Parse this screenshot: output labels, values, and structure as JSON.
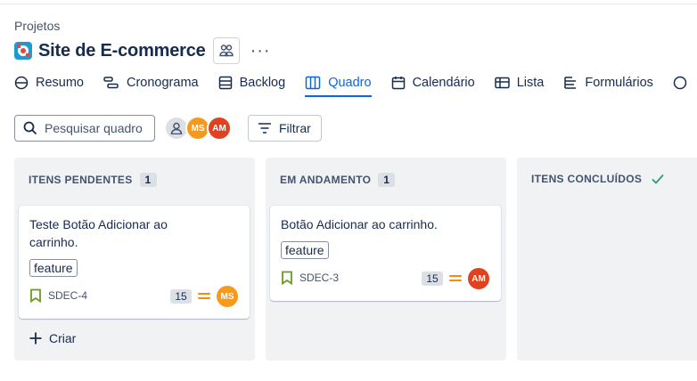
{
  "breadcrumb": "Projetos",
  "project": {
    "title": "Site de E-commerce"
  },
  "header": {
    "more_label": "···"
  },
  "tabs": [
    {
      "label": "Resumo",
      "icon": "globe-icon"
    },
    {
      "label": "Cronograma",
      "icon": "timeline-icon"
    },
    {
      "label": "Backlog",
      "icon": "backlog-icon"
    },
    {
      "label": "Quadro",
      "icon": "board-icon",
      "active": true
    },
    {
      "label": "Calendário",
      "icon": "calendar-icon"
    },
    {
      "label": "Lista",
      "icon": "list-icon"
    },
    {
      "label": "Formulários",
      "icon": "forms-icon"
    }
  ],
  "toolbar": {
    "search_placeholder": "Pesquisar quadro",
    "avatars": [
      "MS",
      "AM"
    ],
    "filter_label": "Filtrar"
  },
  "columns": [
    {
      "title": "ITENS PENDENTES",
      "count": "1",
      "cards": [
        {
          "title_lines": [
            "Teste Botão Adicionar ao",
            "carrinho."
          ],
          "tag": "feature",
          "key": "SDEC-4",
          "estimate": "15",
          "assignee": "MS"
        }
      ],
      "create_label": "Criar"
    },
    {
      "title": "EM ANDAMENTO",
      "count": "1",
      "cards": [
        {
          "title_lines": [
            "Botão Adicionar ao carrinho."
          ],
          "tag": "feature",
          "key": "SDEC-3",
          "estimate": "15",
          "assignee": "AM"
        }
      ]
    },
    {
      "title": "ITENS CONCLUÍDOS",
      "done": true,
      "cards": []
    }
  ],
  "colors": {
    "accent": "#0c66e4",
    "avatar_ms": "#f59a1c",
    "avatar_am": "#e0411f",
    "priority_medium": "#f18d13",
    "story_icon": "#6a9a23",
    "done_check": "#22a06b"
  }
}
